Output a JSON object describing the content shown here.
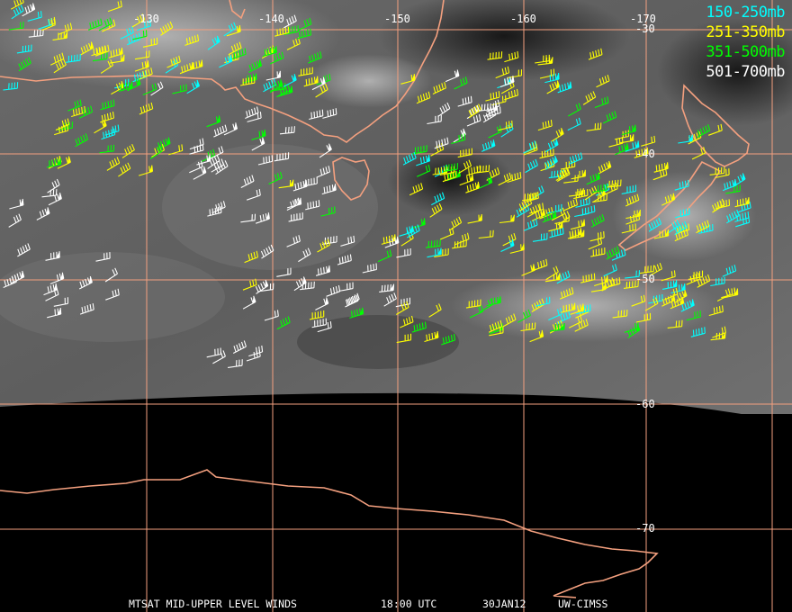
{
  "map": {
    "grid": {
      "longitude_labels": [
        "-130",
        "-140",
        "-150",
        "-160",
        "-170"
      ],
      "latitude_labels": [
        "-30",
        "-40",
        "-50",
        "-60",
        "-70"
      ],
      "line_color": "#f4a07f"
    },
    "coastline_color": "#f4a07f",
    "legend": [
      {
        "label": "150-250mb",
        "color": "#00ffff"
      },
      {
        "label": "251-350mb",
        "color": "#ffff00"
      },
      {
        "label": "351-500mb",
        "color": "#00ff00"
      },
      {
        "label": "501-700mb",
        "color": "#ffffff"
      }
    ],
    "footer": {
      "product": "MTSAT MID-UPPER LEVEL WINDS",
      "time": "18:00 UTC",
      "date": "30JAN12",
      "source": "UW-CIMSS"
    }
  }
}
